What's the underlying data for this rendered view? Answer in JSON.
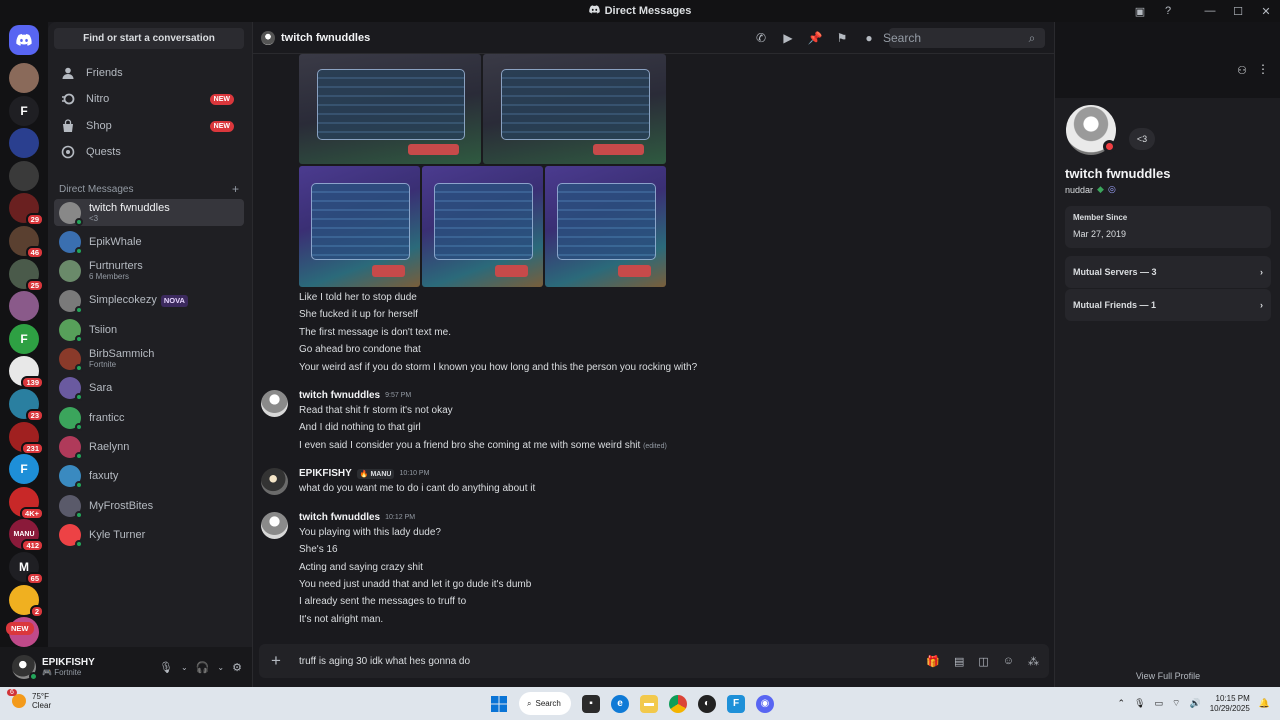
{
  "window": {
    "title": "Direct Messages"
  },
  "servers": [
    {
      "label": "",
      "color": "#8a6a5a",
      "badge": ""
    },
    {
      "label": "F",
      "color": "#1f1f23",
      "badge": ""
    },
    {
      "label": "",
      "color": "#2a3f8f",
      "badge": ""
    },
    {
      "label": "",
      "color": "#3a3a3a",
      "badge": ""
    },
    {
      "label": "",
      "color": "#6a2020",
      "badge": "29"
    },
    {
      "label": "",
      "color": "#5a4030",
      "badge": "46"
    },
    {
      "label": "",
      "color": "#4a5a4a",
      "badge": "25"
    },
    {
      "label": "",
      "color": "#8a5a8a",
      "badge": ""
    },
    {
      "label": "F",
      "color": "#2ea043",
      "badge": ""
    },
    {
      "label": "",
      "color": "#e8e8e8",
      "badge": "139"
    },
    {
      "label": "",
      "color": "#2a7fa0",
      "badge": "23"
    },
    {
      "label": "",
      "color": "#a02020",
      "badge": "231"
    },
    {
      "label": "F",
      "color": "#1e8fd8",
      "badge": ""
    },
    {
      "label": "",
      "color": "#c82828",
      "badge": "4K+"
    },
    {
      "label": "MANU",
      "color": "#8a1a3a",
      "badge": "412"
    },
    {
      "label": "M",
      "color": "#1f1f23",
      "badge": "65"
    },
    {
      "label": "",
      "color": "#f0b020",
      "badge": "2"
    },
    {
      "label": "",
      "color": "#c04a8a",
      "badge": ""
    }
  ],
  "servers_new": "NEW",
  "sidebar": {
    "find": "Find or start a conversation",
    "nav": [
      {
        "label": "Friends",
        "badge": ""
      },
      {
        "label": "Nitro",
        "badge": "NEW"
      },
      {
        "label": "Shop",
        "badge": "NEW"
      },
      {
        "label": "Quests",
        "badge": ""
      }
    ],
    "dm_header": "Direct Messages",
    "dms": [
      {
        "name": "twitch fwnuddles",
        "sub": "<3",
        "color": "#888"
      },
      {
        "name": "EpikWhale",
        "sub": "",
        "color": "#3a6fb0"
      },
      {
        "name": "Furtnurters",
        "sub": "6 Members",
        "color": "#6a8a6a"
      },
      {
        "name": "Simplecokezy",
        "sub": "",
        "color": "#7a7a7a",
        "tag": "NOVA"
      },
      {
        "name": "Tsiion",
        "sub": "",
        "color": "#57a05a"
      },
      {
        "name": "BirbSammich",
        "sub": "Fortnite",
        "color": "#8a3a2a"
      },
      {
        "name": "Sara",
        "sub": "",
        "color": "#6a5aa0"
      },
      {
        "name": "franticc",
        "sub": "",
        "color": "#3ba55c"
      },
      {
        "name": "Raelynn",
        "sub": "",
        "color": "#b03a5a"
      },
      {
        "name": "faxuty",
        "sub": "",
        "color": "#3a8ac0"
      },
      {
        "name": "MyFrostBites",
        "sub": "",
        "color": "#5a5a6a"
      },
      {
        "name": "Kyle Turner",
        "sub": "",
        "color": "#ed4245"
      }
    ]
  },
  "user": {
    "name": "EPIKFISHY",
    "status": "Fortnite"
  },
  "chat": {
    "header_name": "twitch fwnuddles",
    "search_placeholder": "Search",
    "block1": [
      "Like I told her to stop dude",
      "She fucked it up for herself",
      "The first message is don't text me.",
      "Go ahead bro condone that",
      "Your weird asf if you do storm I known you how long and this the person you rocking with?"
    ],
    "msg2": {
      "author": "twitch fwnuddles",
      "time": "9:57 PM",
      "lines": [
        "Read that shit fr storm it's not okay",
        "And I did nothing to that girl",
        "I even said I consider you a friend bro she coming at me with some weird  shit"
      ],
      "edited": "(edited)"
    },
    "msg3": {
      "author": "EPIKFISHY",
      "tag": "MANU",
      "time": "10:10 PM",
      "lines": [
        "what do you want me to do i cant do anything about it"
      ]
    },
    "msg4": {
      "author": "twitch fwnuddles",
      "time": "10:12 PM",
      "lines": [
        "You playing with this lady dude?",
        "She's 16",
        "Acting and saying crazy shit",
        "You need just unadd that and let it go dude it's dumb",
        "I already sent the messages to truff to",
        "It's not alright man."
      ]
    },
    "composer_text": "truff is aging 30 idk what hes gonna do"
  },
  "profile": {
    "bubble": "<3",
    "display_name": "twitch fwnuddles",
    "username": "nuddar",
    "member_since_label": "Member Since",
    "member_since": "Mar 27, 2019",
    "mutual_servers": "Mutual Servers — 3",
    "mutual_friends": "Mutual Friends — 1",
    "view_full": "View Full Profile"
  },
  "taskbar": {
    "weather_badge": "6",
    "temp": "75°F",
    "condition": "Clear",
    "search": "Search",
    "time": "10:15 PM",
    "date": "10/29/2025"
  }
}
